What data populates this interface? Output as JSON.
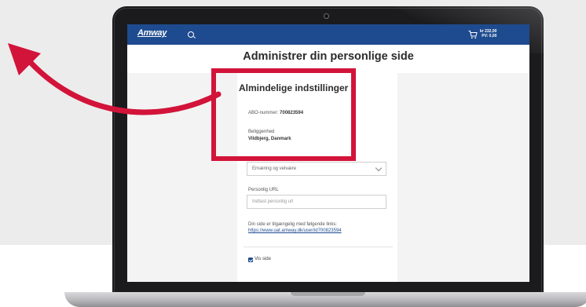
{
  "header": {
    "logo": "Amway",
    "cart_amount": "kr 232,00",
    "cart_pv": "PV: 0,00"
  },
  "page": {
    "title": "Administrer din personlige side"
  },
  "settings": {
    "section_title": "Almindelige indstillinger",
    "abo_label": "ABO-nummer:",
    "abo_number": "700823594",
    "location_label": "Beliggenhed",
    "location_value": "Vildbjerg, Danmark",
    "category_selected": "Ernæring og velvære",
    "url_label": "Personlig URL",
    "url_placeholder": "Indtast personlig url",
    "available_text": "Din side er tilgængelig med følgende links:",
    "available_link": "https://www.uat.amway.dk/user/id700823594",
    "show_page_label": "Vis side",
    "show_page_checked": true
  },
  "icons": {
    "search": "search-icon",
    "cart": "cart-icon",
    "dropdown": "chevron-down-icon",
    "arrow": "curved-arrow-icon"
  },
  "colors": {
    "topbar": "#1e4b8f",
    "highlight": "#d2143a"
  }
}
